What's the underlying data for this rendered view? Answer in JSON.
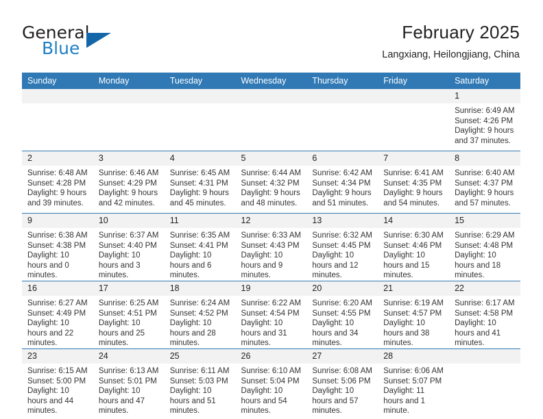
{
  "brand": {
    "name_part1": "General",
    "name_part2": "Blue"
  },
  "header": {
    "title": "February 2025",
    "subtitle": "Langxiang, Heilongjiang, China"
  },
  "colors": {
    "header_blue": "#3079b5",
    "brand_blue": "#1f7fc4",
    "daynum_gray": "#f2f2f2"
  },
  "weekday_headers": [
    "Sunday",
    "Monday",
    "Tuesday",
    "Wednesday",
    "Thursday",
    "Friday",
    "Saturday"
  ],
  "weeks": [
    [
      {
        "day": "",
        "empty": true
      },
      {
        "day": "",
        "empty": true
      },
      {
        "day": "",
        "empty": true
      },
      {
        "day": "",
        "empty": true
      },
      {
        "day": "",
        "empty": true
      },
      {
        "day": "",
        "empty": true
      },
      {
        "day": "1",
        "sunrise": "Sunrise: 6:49 AM",
        "sunset": "Sunset: 4:26 PM",
        "daylight": "Daylight: 9 hours and 37 minutes."
      }
    ],
    [
      {
        "day": "2",
        "sunrise": "Sunrise: 6:48 AM",
        "sunset": "Sunset: 4:28 PM",
        "daylight": "Daylight: 9 hours and 39 minutes."
      },
      {
        "day": "3",
        "sunrise": "Sunrise: 6:46 AM",
        "sunset": "Sunset: 4:29 PM",
        "daylight": "Daylight: 9 hours and 42 minutes."
      },
      {
        "day": "4",
        "sunrise": "Sunrise: 6:45 AM",
        "sunset": "Sunset: 4:31 PM",
        "daylight": "Daylight: 9 hours and 45 minutes."
      },
      {
        "day": "5",
        "sunrise": "Sunrise: 6:44 AM",
        "sunset": "Sunset: 4:32 PM",
        "daylight": "Daylight: 9 hours and 48 minutes."
      },
      {
        "day": "6",
        "sunrise": "Sunrise: 6:42 AM",
        "sunset": "Sunset: 4:34 PM",
        "daylight": "Daylight: 9 hours and 51 minutes."
      },
      {
        "day": "7",
        "sunrise": "Sunrise: 6:41 AM",
        "sunset": "Sunset: 4:35 PM",
        "daylight": "Daylight: 9 hours and 54 minutes."
      },
      {
        "day": "8",
        "sunrise": "Sunrise: 6:40 AM",
        "sunset": "Sunset: 4:37 PM",
        "daylight": "Daylight: 9 hours and 57 minutes."
      }
    ],
    [
      {
        "day": "9",
        "sunrise": "Sunrise: 6:38 AM",
        "sunset": "Sunset: 4:38 PM",
        "daylight": "Daylight: 10 hours and 0 minutes."
      },
      {
        "day": "10",
        "sunrise": "Sunrise: 6:37 AM",
        "sunset": "Sunset: 4:40 PM",
        "daylight": "Daylight: 10 hours and 3 minutes."
      },
      {
        "day": "11",
        "sunrise": "Sunrise: 6:35 AM",
        "sunset": "Sunset: 4:41 PM",
        "daylight": "Daylight: 10 hours and 6 minutes."
      },
      {
        "day": "12",
        "sunrise": "Sunrise: 6:33 AM",
        "sunset": "Sunset: 4:43 PM",
        "daylight": "Daylight: 10 hours and 9 minutes."
      },
      {
        "day": "13",
        "sunrise": "Sunrise: 6:32 AM",
        "sunset": "Sunset: 4:45 PM",
        "daylight": "Daylight: 10 hours and 12 minutes."
      },
      {
        "day": "14",
        "sunrise": "Sunrise: 6:30 AM",
        "sunset": "Sunset: 4:46 PM",
        "daylight": "Daylight: 10 hours and 15 minutes."
      },
      {
        "day": "15",
        "sunrise": "Sunrise: 6:29 AM",
        "sunset": "Sunset: 4:48 PM",
        "daylight": "Daylight: 10 hours and 18 minutes."
      }
    ],
    [
      {
        "day": "16",
        "sunrise": "Sunrise: 6:27 AM",
        "sunset": "Sunset: 4:49 PM",
        "daylight": "Daylight: 10 hours and 22 minutes."
      },
      {
        "day": "17",
        "sunrise": "Sunrise: 6:25 AM",
        "sunset": "Sunset: 4:51 PM",
        "daylight": "Daylight: 10 hours and 25 minutes."
      },
      {
        "day": "18",
        "sunrise": "Sunrise: 6:24 AM",
        "sunset": "Sunset: 4:52 PM",
        "daylight": "Daylight: 10 hours and 28 minutes."
      },
      {
        "day": "19",
        "sunrise": "Sunrise: 6:22 AM",
        "sunset": "Sunset: 4:54 PM",
        "daylight": "Daylight: 10 hours and 31 minutes."
      },
      {
        "day": "20",
        "sunrise": "Sunrise: 6:20 AM",
        "sunset": "Sunset: 4:55 PM",
        "daylight": "Daylight: 10 hours and 34 minutes."
      },
      {
        "day": "21",
        "sunrise": "Sunrise: 6:19 AM",
        "sunset": "Sunset: 4:57 PM",
        "daylight": "Daylight: 10 hours and 38 minutes."
      },
      {
        "day": "22",
        "sunrise": "Sunrise: 6:17 AM",
        "sunset": "Sunset: 4:58 PM",
        "daylight": "Daylight: 10 hours and 41 minutes."
      }
    ],
    [
      {
        "day": "23",
        "sunrise": "Sunrise: 6:15 AM",
        "sunset": "Sunset: 5:00 PM",
        "daylight": "Daylight: 10 hours and 44 minutes."
      },
      {
        "day": "24",
        "sunrise": "Sunrise: 6:13 AM",
        "sunset": "Sunset: 5:01 PM",
        "daylight": "Daylight: 10 hours and 47 minutes."
      },
      {
        "day": "25",
        "sunrise": "Sunrise: 6:11 AM",
        "sunset": "Sunset: 5:03 PM",
        "daylight": "Daylight: 10 hours and 51 minutes."
      },
      {
        "day": "26",
        "sunrise": "Sunrise: 6:10 AM",
        "sunset": "Sunset: 5:04 PM",
        "daylight": "Daylight: 10 hours and 54 minutes."
      },
      {
        "day": "27",
        "sunrise": "Sunrise: 6:08 AM",
        "sunset": "Sunset: 5:06 PM",
        "daylight": "Daylight: 10 hours and 57 minutes."
      },
      {
        "day": "28",
        "sunrise": "Sunrise: 6:06 AM",
        "sunset": "Sunset: 5:07 PM",
        "daylight": "Daylight: 11 hours and 1 minute."
      },
      {
        "day": "",
        "empty": true
      }
    ]
  ]
}
